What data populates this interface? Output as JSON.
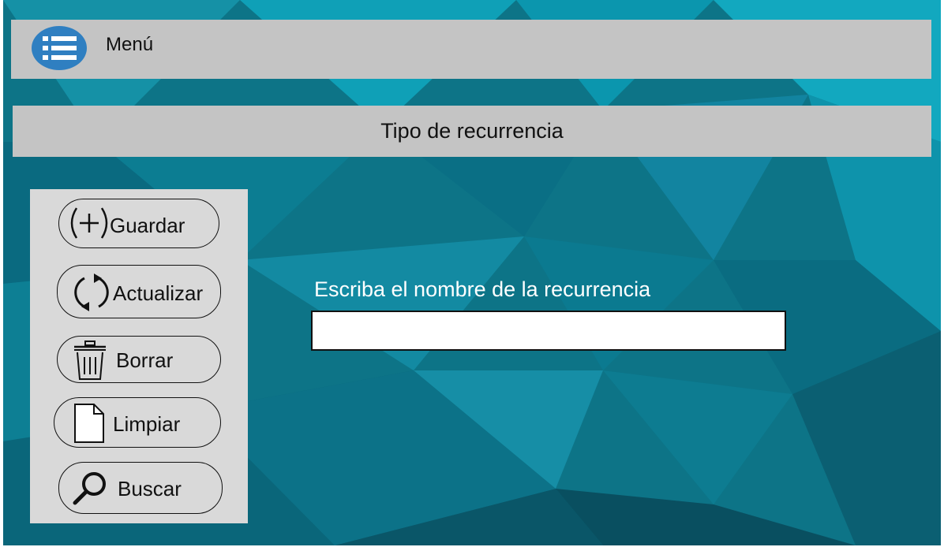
{
  "header": {
    "menu_label": "Menú",
    "menu_icon": "list-menu-icon"
  },
  "page": {
    "title": "Tipo de recurrencia"
  },
  "actions": [
    {
      "label": "Guardar",
      "icon": "plus-circle-icon"
    },
    {
      "label": "Actualizar",
      "icon": "refresh-icon"
    },
    {
      "label": "Borrar",
      "icon": "trash-icon"
    },
    {
      "label": "Limpiar",
      "icon": "document-icon"
    },
    {
      "label": "Buscar",
      "icon": "search-icon"
    }
  ],
  "form": {
    "name_label": "Escriba el nombre de la recurrencia",
    "name_value": ""
  },
  "colors": {
    "header_bg": "#c4c4c4",
    "panel_bg": "#d9d9d9",
    "menu_icon_bg": "#2f7fc1",
    "background_teal": "#0b6b7f"
  }
}
